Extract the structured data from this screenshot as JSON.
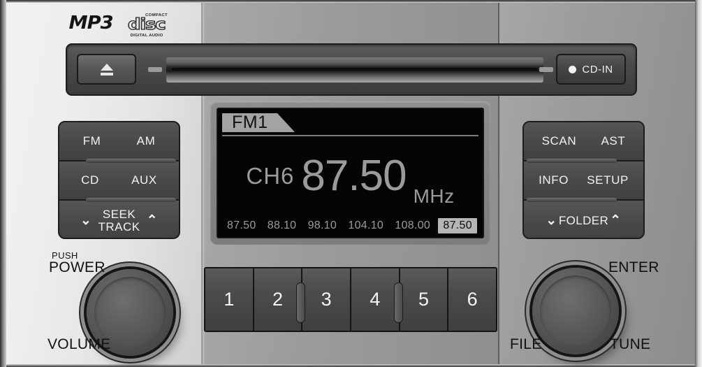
{
  "device": {
    "type": "car-audio-head-unit",
    "logos": {
      "mp3": "MP3",
      "cd_top": "COMPACT",
      "cd_mid": "disc",
      "cd_bottom": "DIGITAL AUDIO"
    }
  },
  "cd_bar": {
    "eject_icon": "eject-icon",
    "cd_in_label": "CD-IN"
  },
  "left_buttons": {
    "row1": {
      "left": "FM",
      "right": "AM"
    },
    "row2": {
      "left": "CD",
      "right": "AUX"
    },
    "row3": {
      "down_chevron": "⌄",
      "line1": "SEEK",
      "line2": "TRACK",
      "up_chevron": "⌃"
    }
  },
  "right_buttons": {
    "row1": {
      "left": "SCAN",
      "right": "AST"
    },
    "row2": {
      "left": "INFO",
      "right": "SETUP"
    },
    "row3": {
      "down_chevron": "⌄",
      "label": "FOLDER",
      "up_chevron": "⌃"
    }
  },
  "display": {
    "band_tab": "FM1",
    "channel": "CH6",
    "frequency": "87.50",
    "unit": "MHz",
    "presets": [
      {
        "value": "87.50",
        "active": false
      },
      {
        "value": "88.10",
        "active": false
      },
      {
        "value": "98.10",
        "active": false
      },
      {
        "value": "104.10",
        "active": false
      },
      {
        "value": "108.00",
        "active": false
      },
      {
        "value": "87.50",
        "active": true
      }
    ]
  },
  "preset_buttons": [
    "1",
    "2",
    "3",
    "4",
    "5",
    "6"
  ],
  "knobs": {
    "left": {
      "name": "volume-power-knob",
      "label_top_small": "PUSH",
      "label_top": "POWER",
      "label_bottom": "VOLUME"
    },
    "right": {
      "name": "tune-enter-knob",
      "label_enter": "ENTER",
      "label_file": "FILE",
      "label_tune": "TUNE"
    }
  },
  "colors": {
    "face_light": "#f2f2f2",
    "face_dark": "#8c8c8c",
    "center_column": "#9a9a9a",
    "button_dark": "#4a4a4a",
    "lcd_background": "#050505",
    "lcd_text": "#9b9b9b",
    "lcd_tab_bg": "#a3a3a3",
    "preset_highlight": "#b5b5b5"
  }
}
